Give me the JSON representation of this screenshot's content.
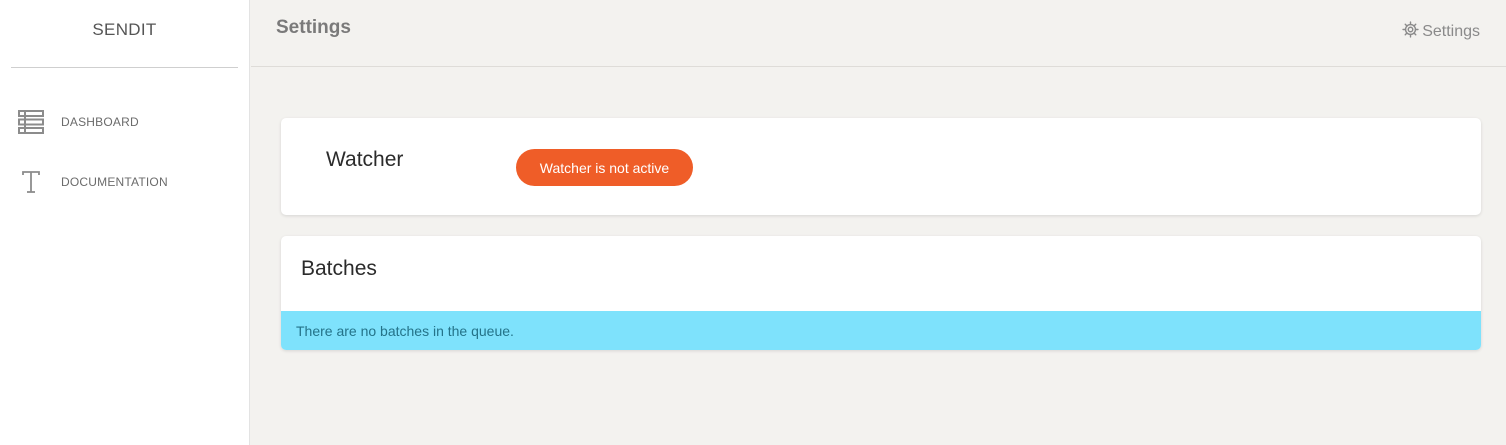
{
  "sidebar": {
    "brand": "SENDIT",
    "items": [
      {
        "label": "DASHBOARD",
        "icon": "list-icon"
      },
      {
        "label": "DOCUMENTATION",
        "icon": "text-icon"
      }
    ]
  },
  "header": {
    "title": "Settings",
    "settings_link": "Settings",
    "settings_icon": "gear-icon"
  },
  "watcher": {
    "title": "Watcher",
    "status": "Watcher is not active",
    "status_color": "#ef5d28"
  },
  "batches": {
    "title": "Batches",
    "empty_message": "There are no batches in the queue.",
    "alert_color": "#7ee2fc"
  }
}
